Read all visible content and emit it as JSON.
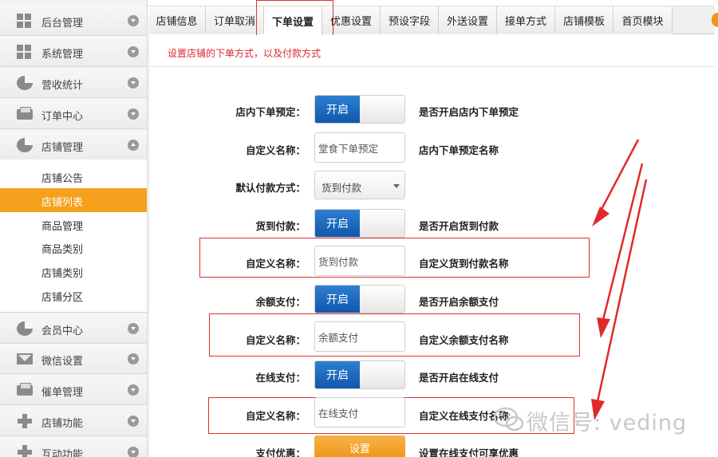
{
  "sidebar": {
    "items": [
      {
        "label": "后台管理",
        "icon": "grid-icon"
      },
      {
        "label": "系统管理",
        "icon": "grid-icon"
      },
      {
        "label": "营收统计",
        "icon": "pie-chart-icon"
      },
      {
        "label": "订单中心",
        "icon": "printer-icon"
      },
      {
        "label": "店铺管理",
        "icon": "pie-chart-icon"
      },
      {
        "label": "会员中心",
        "icon": "pie-chart-icon"
      },
      {
        "label": "微信设置",
        "icon": "mail-icon"
      },
      {
        "label": "催单管理",
        "icon": "printer-icon"
      },
      {
        "label": "店铺功能",
        "icon": "plus-icon"
      },
      {
        "label": "互动功能",
        "icon": "plus-icon"
      }
    ],
    "submenu": [
      "店铺公告",
      "店铺列表",
      "商品管理",
      "商品类别",
      "店铺类别",
      "店铺分区"
    ],
    "active_submenu": "店铺列表"
  },
  "tabs": [
    "店铺信息",
    "订单取消",
    "下单设置",
    "优惠设置",
    "预设字段",
    "外送设置",
    "接单方式",
    "店铺模板",
    "首页模块"
  ],
  "active_tab": "下单设置",
  "hint": "设置店铺的下单方式，以及付款方式",
  "form": {
    "rows": [
      {
        "label": "店内下单预定：",
        "toggle": "开启",
        "desc": "是否开启店内下单预定"
      },
      {
        "label": "自定义名称：",
        "value": "堂食下单预定",
        "desc": "店内下单预定名称"
      },
      {
        "label": "默认付款方式：",
        "select": "货到付款"
      },
      {
        "label": "货到付款：",
        "toggle": "开启",
        "desc": "是否开启货到付款"
      },
      {
        "label": "自定义名称：",
        "value": "货到付款",
        "desc": "自定义货到付款名称"
      },
      {
        "label": "余额支付：",
        "toggle": "开启",
        "desc": "是否开启余额支付"
      },
      {
        "label": "自定义名称：",
        "value": "余额支付",
        "desc": "自定义余额支付名称"
      },
      {
        "label": "在线支付：",
        "toggle": "开启",
        "desc": "是否开启在线支付"
      },
      {
        "label": "自定义名称：",
        "value": "在线支付",
        "desc": "自定义在线支付名称"
      },
      {
        "label": "支付优惠：",
        "button": "设置",
        "desc": "设置在线支付可享优惠"
      }
    ]
  },
  "watermark": "微信号: veding",
  "colors": {
    "accent_orange": "#f5a11d",
    "toggle_blue": "#1a66bf",
    "highlight_red": "#d93434",
    "hint_red": "#d9272c"
  }
}
